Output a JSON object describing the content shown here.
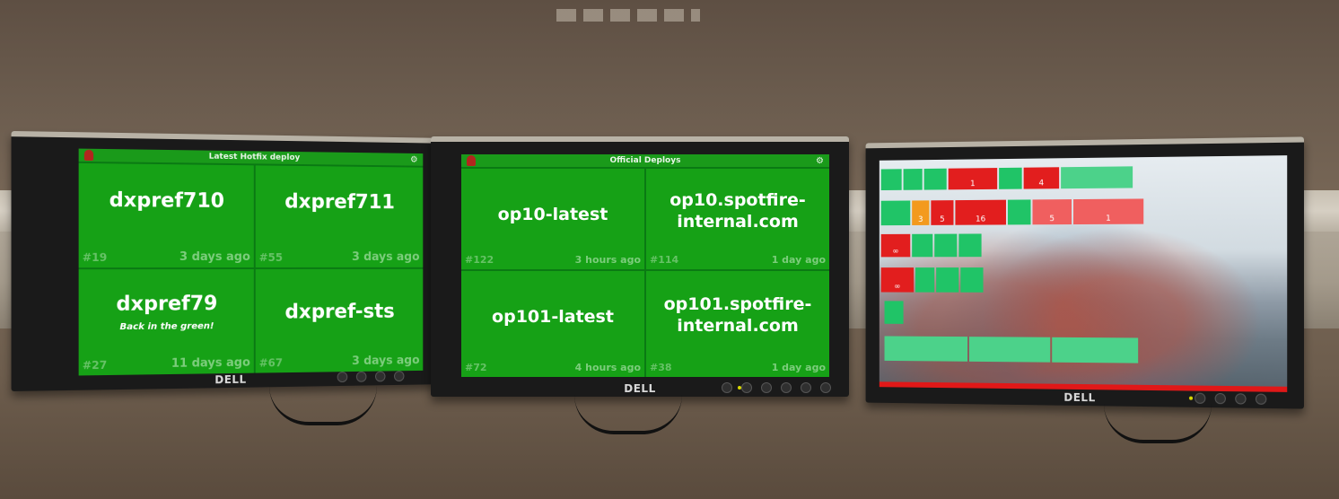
{
  "monitors": {
    "left": {
      "title": "Latest Hotfix deploy",
      "brand": "DELL",
      "tiles": [
        {
          "name": "dxpref710",
          "number": "#19",
          "age": "3 days ago",
          "note": ""
        },
        {
          "name": "dxpref711",
          "number": "#55",
          "age": "3 days ago",
          "note": ""
        },
        {
          "name": "dxpref79",
          "number": "#27",
          "age": "11 days ago",
          "note": "Back in the green!"
        },
        {
          "name": "dxpref-sts",
          "number": "#67",
          "age": "3 days ago",
          "note": ""
        }
      ]
    },
    "center": {
      "title": "Official Deploys",
      "brand": "DELL",
      "tiles": [
        {
          "name": "op10-latest",
          "number": "#122",
          "age": "3 hours ago"
        },
        {
          "name": "op10.spotfire-internal.com",
          "name_line1": "op10.spotfire-",
          "name_line2": "internal.com",
          "number": "#114",
          "age": "1 day ago"
        },
        {
          "name": "op101-latest",
          "number": "#72",
          "age": "4 hours ago"
        },
        {
          "name": "op101.spotfire-internal.com",
          "name_line1": "op101.spotfire-",
          "name_line2": "internal.com",
          "number": "#38",
          "age": "1 day ago"
        }
      ]
    },
    "right": {
      "brand": "DELL",
      "row1_values": [
        "1",
        "4"
      ],
      "row2_values": [
        "3",
        "5",
        "16",
        "5",
        "1"
      ],
      "row3_values": [
        "∞"
      ],
      "row4_values": [
        "∞"
      ]
    }
  },
  "colors": {
    "tile_green": "#16a116",
    "status_red": "#e21e1e",
    "status_green": "#20c467",
    "status_orange": "#f39a1e"
  }
}
